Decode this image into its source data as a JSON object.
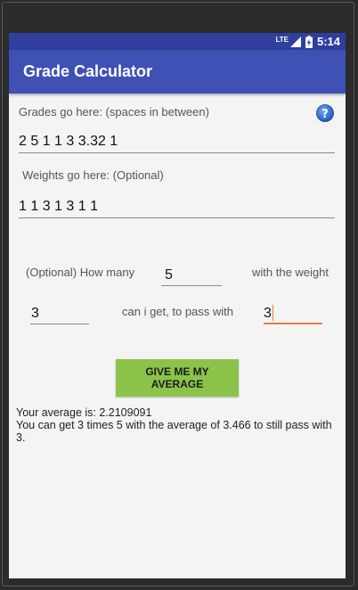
{
  "status_bar": {
    "network": "LTE",
    "time": "5:14"
  },
  "app_bar": {
    "title": "Grade Calculator"
  },
  "form": {
    "grades_label": "Grades go here: (spaces in between)",
    "grades_value": "2 5 1 1 3 3.32 1",
    "weights_label": "Weights go here: (Optional)",
    "weights_value": "1 1 3 1 3 1 1",
    "how_many_label": "(Optional) How many",
    "how_many_value": "5",
    "with_weight_label": "with the weight",
    "weight_value": "3",
    "can_i_get_label": "can i get, to pass with",
    "pass_value": "3"
  },
  "actions": {
    "average_button": "GIVE ME MY AVERAGE"
  },
  "result": {
    "line1": "Your average is: 2.2109091",
    "line2": "You can get 3 times 5 with the average of 3.466 to still pass with 3."
  },
  "colors": {
    "status_bar": "#2f3f9e",
    "app_bar": "#3f51b5",
    "button": "#8bc34a",
    "accent": "#e97d3a",
    "background": "#f4f4f4"
  },
  "icons": {
    "help": "help-icon",
    "battery": "battery-icon",
    "signal": "signal-icon"
  }
}
